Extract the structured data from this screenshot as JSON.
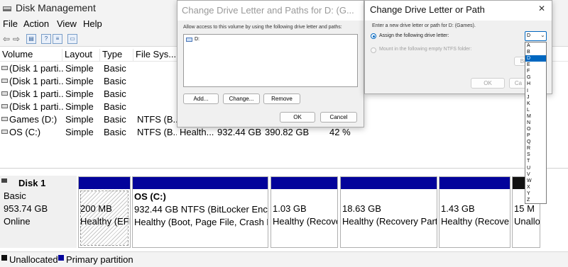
{
  "main": {
    "title": "Disk Management",
    "menu": [
      "File",
      "Action",
      "View",
      "Help"
    ],
    "columns": [
      "Volume",
      "Layout",
      "Type",
      "File Sys..."
    ],
    "volumes": [
      {
        "volume": "(Disk 1 parti...",
        "layout": "Simple",
        "type": "Basic",
        "fs": "",
        "status": "",
        "capacity": "",
        "free": "",
        "pct": ""
      },
      {
        "volume": "(Disk 1 parti...",
        "layout": "Simple",
        "type": "Basic",
        "fs": "",
        "status": "",
        "capacity": "",
        "free": "",
        "pct": ""
      },
      {
        "volume": "(Disk 1 parti...",
        "layout": "Simple",
        "type": "Basic",
        "fs": "",
        "status": "",
        "capacity": "",
        "free": "",
        "pct": ""
      },
      {
        "volume": "(Disk 1 parti...",
        "layout": "Simple",
        "type": "Basic",
        "fs": "",
        "status": "",
        "capacity": "",
        "free": "",
        "pct": ""
      },
      {
        "volume": "Games (D:)",
        "layout": "Simple",
        "type": "Basic",
        "fs": "NTFS (B...",
        "status": "",
        "capacity": "",
        "free": "",
        "pct": ""
      },
      {
        "volume": "OS (C:)",
        "layout": "Simple",
        "type": "Basic",
        "fs": "NTFS (B...",
        "status": "Health...",
        "capacity": "932.44 GB",
        "free": "390.82 GB",
        "pct": "42 %"
      }
    ],
    "disk": {
      "name": "Disk 1",
      "type": "Basic",
      "size": "953.74 GB",
      "state": "Online"
    },
    "partitions": [
      {
        "name": "",
        "line1": "200 MB",
        "line2": "Healthy (EFI"
      },
      {
        "name": "OS  (C:)",
        "line1": "932.44 GB NTFS (BitLocker Encryp",
        "line2": "Healthy (Boot, Page File, Crash Du"
      },
      {
        "name": "",
        "line1": "1.03 GB",
        "line2": "Healthy (Recove"
      },
      {
        "name": "",
        "line1": "18.63 GB",
        "line2": "Healthy (Recovery Parti"
      },
      {
        "name": "",
        "line1": "1.43 GB",
        "line2": "Healthy (Recover"
      },
      {
        "name": "",
        "line1": "15 M",
        "line2": "Unallo"
      }
    ],
    "legend": [
      "Unallocated",
      "Primary partition"
    ],
    "colors": {
      "primary": "#03039b",
      "unallocated": "#111111",
      "accent": "#0067c0"
    }
  },
  "dialog_paths": {
    "title": "Change Drive Letter and Paths for D: (G...",
    "instruction": "Allow access to this volume by using the following drive letter and paths:",
    "list_item": "D:",
    "add_label": "Add...",
    "change_label": "Change...",
    "remove_label": "Remove",
    "ok_label": "OK",
    "cancel_label": "Cancel"
  },
  "dialog_letter": {
    "title": "Change Drive Letter or Path",
    "close_glyph": "✕",
    "instruction": "Enter a new drive letter or path for D: (Games).",
    "assign_label": "Assign the following drive letter:",
    "mount_label": "Mount in the following empty NTFS folder:",
    "browse_label": "Bro",
    "ok_label": "OK",
    "cancel_label": "Ca",
    "selected_letter": "D",
    "letters": [
      "A",
      "B",
      "D",
      "E",
      "F",
      "G",
      "H",
      "I",
      "J",
      "K",
      "L",
      "M",
      "N",
      "O",
      "P",
      "Q",
      "R",
      "S",
      "T",
      "U",
      "V",
      "W",
      "X",
      "Y",
      "Z"
    ]
  }
}
